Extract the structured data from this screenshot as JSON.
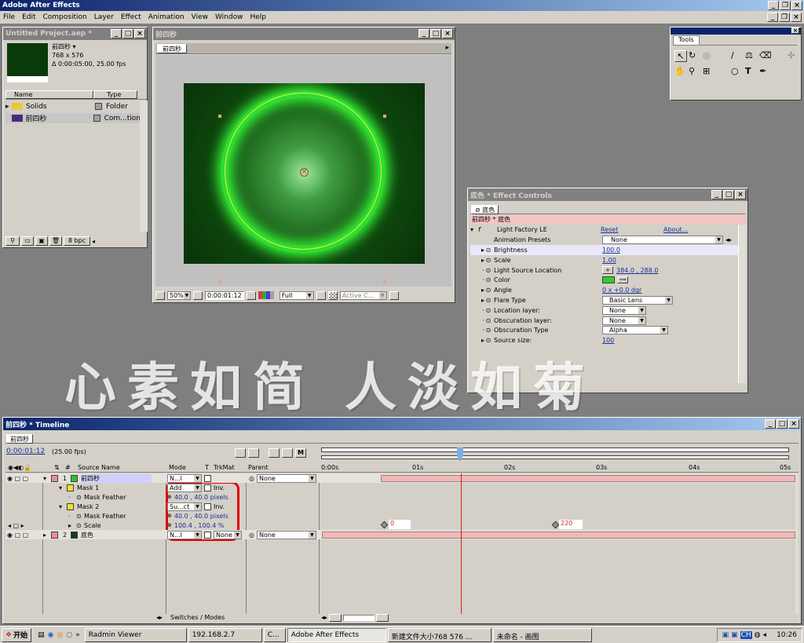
{
  "app": {
    "title": "Adobe After Effects",
    "menu": [
      "File",
      "Edit",
      "Composition",
      "Layer",
      "Effect",
      "Animation",
      "View",
      "Window",
      "Help"
    ]
  },
  "project": {
    "title": "Untitled Project.aep *",
    "comp_name": "前四秒 ▾",
    "comp_size": "768 x 576",
    "comp_duration": "Δ 0:00:05:00, 25.00 fps",
    "col_name": "Name",
    "col_type": "Type",
    "items": [
      {
        "name": "Solids",
        "type": "Folder"
      },
      {
        "name": "前四秒",
        "type": "Com...tion"
      }
    ],
    "bpc": "8 bpc"
  },
  "comp": {
    "title": "前四秒",
    "tab": "前四秒",
    "zoom": "50%",
    "time": "0:00:01:12",
    "quality": "Full",
    "view": "Active C..."
  },
  "tools": {
    "title": "Tools"
  },
  "effects": {
    "title": "底色 * Effect Controls",
    "tab": "底色",
    "breadcrumb": "前四秒 * 底色",
    "effect_name": "Light Factory LE",
    "reset": "Reset",
    "about": "About...",
    "presets_label": "Animation Presets",
    "presets_value": "None",
    "props": [
      {
        "name": "Brightness",
        "value": "100.0",
        "kind": "num"
      },
      {
        "name": "Scale",
        "value": "1.00",
        "kind": "num"
      },
      {
        "name": "Light Source Location",
        "value": "384.0 , 288.0",
        "kind": "point"
      },
      {
        "name": "Color",
        "value": "",
        "kind": "color"
      },
      {
        "name": "Angle",
        "value": "0 x +0.0 dgr",
        "kind": "num"
      },
      {
        "name": "Flare Type",
        "value": "Basic Lens",
        "kind": "dd"
      },
      {
        "name": "Location layer:",
        "value": "None",
        "kind": "dd"
      },
      {
        "name": "Obscuration layer:",
        "value": "None",
        "kind": "dd"
      },
      {
        "name": "Obscuration Type",
        "value": "Alpha",
        "kind": "dd"
      },
      {
        "name": "Source size:",
        "value": "100",
        "kind": "num"
      }
    ],
    "color_swatch": "#33cc33"
  },
  "watermark": "心素如简 人淡如菊",
  "timeline": {
    "title": "前四秒 * Timeline",
    "tab": "前四秒",
    "time": "0:00:01:12",
    "fps": "(25.00 fps)",
    "col_num": "#",
    "col_source": "Source Name",
    "col_mode": "Mode",
    "col_t": "T",
    "col_trkmat": "TrkMat",
    "col_parent": "Parent",
    "ruler": [
      "0:00s",
      "01s",
      "02s",
      "03s",
      "04s",
      "05s"
    ],
    "rows": [
      {
        "label": "1",
        "name": "前四秒",
        "mode": "N...l",
        "parent": "None"
      },
      {
        "label": "",
        "name": "Mask 1",
        "mode": "Add",
        "inv": "Inv."
      },
      {
        "label": "",
        "name": "Mask Feather",
        "value": "40.0 , 40.0 pixels"
      },
      {
        "label": "",
        "name": "Mask 2",
        "mode": "Su...ct",
        "inv": "Inv."
      },
      {
        "label": "",
        "name": "Mask Feather",
        "value": "40.0 , 40.0 pixels"
      },
      {
        "label": "",
        "name": "Scale",
        "value": "100.4 , 100.4 %"
      },
      {
        "label": "2",
        "name": "底色",
        "mode": "N...l",
        "trkmat": "None",
        "parent": "None"
      }
    ],
    "kf1": "0",
    "kf2": "220",
    "switches": "Switches / Modes"
  },
  "taskbar": {
    "start": "开始",
    "items": [
      "Radmin Viewer",
      "192.168.2.7",
      "C...",
      "Adobe After Effects",
      "新建文件大小768 576 ...",
      "未命名 - 画图"
    ],
    "clock": "10:26",
    "ch": "CH"
  }
}
